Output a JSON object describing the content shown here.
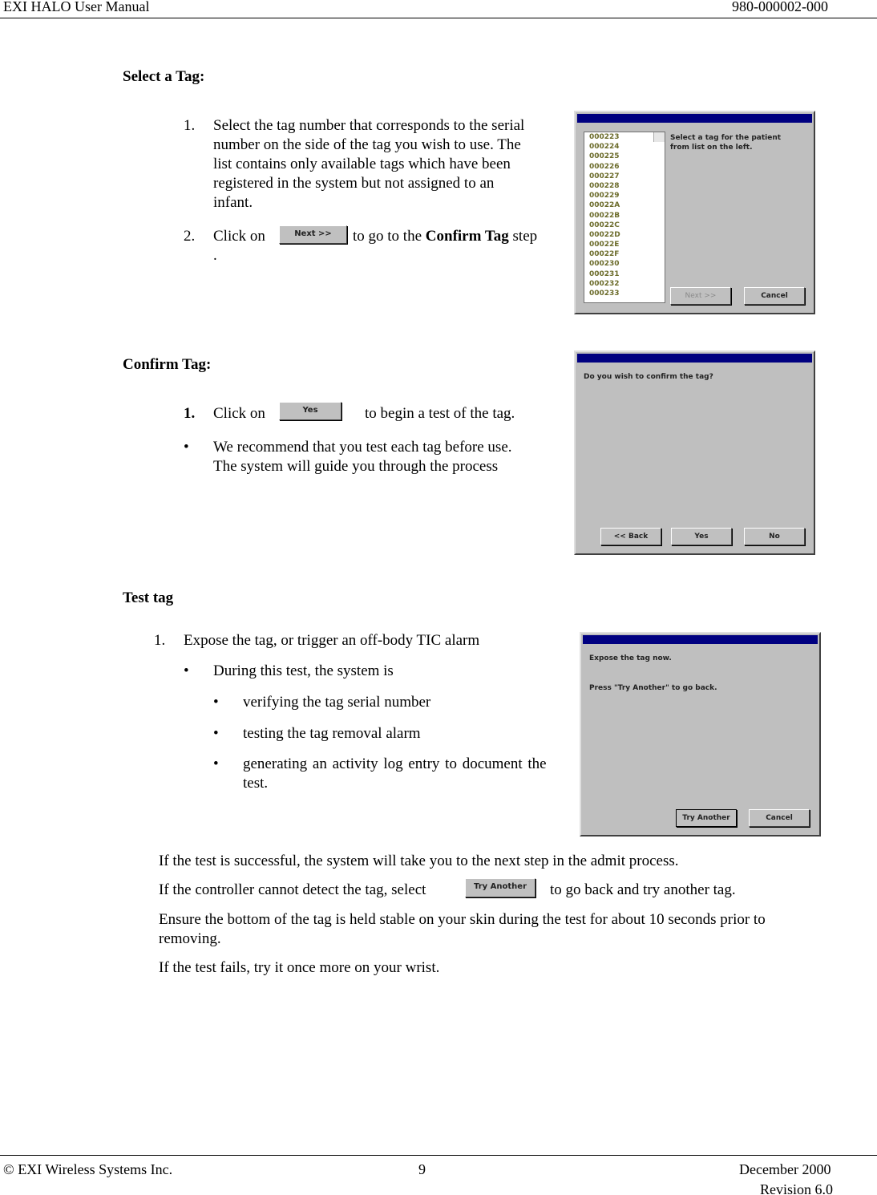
{
  "header": {
    "left": "EXI HALO User Manual",
    "right": "980-000002-000"
  },
  "footer": {
    "copyright_symbol": "©",
    "company": "EXI Wireless Systems Inc.",
    "page": "9",
    "date": "December 2000",
    "revision": "Revision 6.0"
  },
  "select": {
    "heading": "Select a Tag:",
    "step1_num": "1.",
    "step1_lines": [
      "Select the tag number that corresponds to the serial",
      "number on the side of the tag you wish to use. The",
      "list contains only available tags which have been",
      "registered in the system but not assigned to an",
      "infant."
    ],
    "step2_num": "2.",
    "step2_pre": "Click on",
    "step2_button": "Next >>",
    "step2_mid": "to go to the",
    "step2_bold": "Confirm Tag",
    "step2_post": "step",
    "step2_cont": ".",
    "dialog": {
      "message": "Select a tag for the patient from list on the left.",
      "tags": [
        "000223",
        "000224",
        "000225",
        "000226",
        "000227",
        "000228",
        "000229",
        "00022A",
        "00022B",
        "00022C",
        "00022D",
        "00022E",
        "00022F",
        "000230",
        "000231",
        "000232",
        "000233"
      ],
      "next": "Next >>",
      "cancel": "Cancel"
    }
  },
  "confirm": {
    "heading": "Confirm Tag:",
    "step_num": "1.",
    "pre": "Click on",
    "button": "Yes",
    "post": "to begin a test of the tag.",
    "bullet": "•",
    "bullet_lines": [
      "We recommend that you test each tag before use.",
      "The system will guide you through the process"
    ],
    "dialog": {
      "message": "Do you wish to confirm the tag?",
      "back": "<< Back",
      "yes": "Yes",
      "no": "No"
    }
  },
  "test": {
    "heading": "Test tag",
    "step_num": "1.",
    "step": "Expose the tag, or trigger an off-body TIC alarm",
    "bullet": "•",
    "sub": "During this test, the system is",
    "items": [
      "verifying the tag serial number",
      "testing the tag removal alarm",
      "generating an activity log entry to document the"
    ],
    "item3_cont": "test.",
    "dialog": {
      "line1": "Expose the tag now.",
      "line2": "Press \"Try Another\" to go back.",
      "try": "Try Another",
      "cancel": "Cancel"
    },
    "p1": "If the test is successful, the system will take you to the next step in the admit process.",
    "p2_pre": "If the controller cannot detect the tag, select",
    "p2_button": "Try Another",
    "p2_post": "to go back and try another tag.",
    "p3_l1": "Ensure the bottom of the tag is held stable on your skin during the test for about 10 seconds prior to",
    "p3_l2": "removing.",
    "p4": "If the test fails, try it once more on your wrist."
  }
}
